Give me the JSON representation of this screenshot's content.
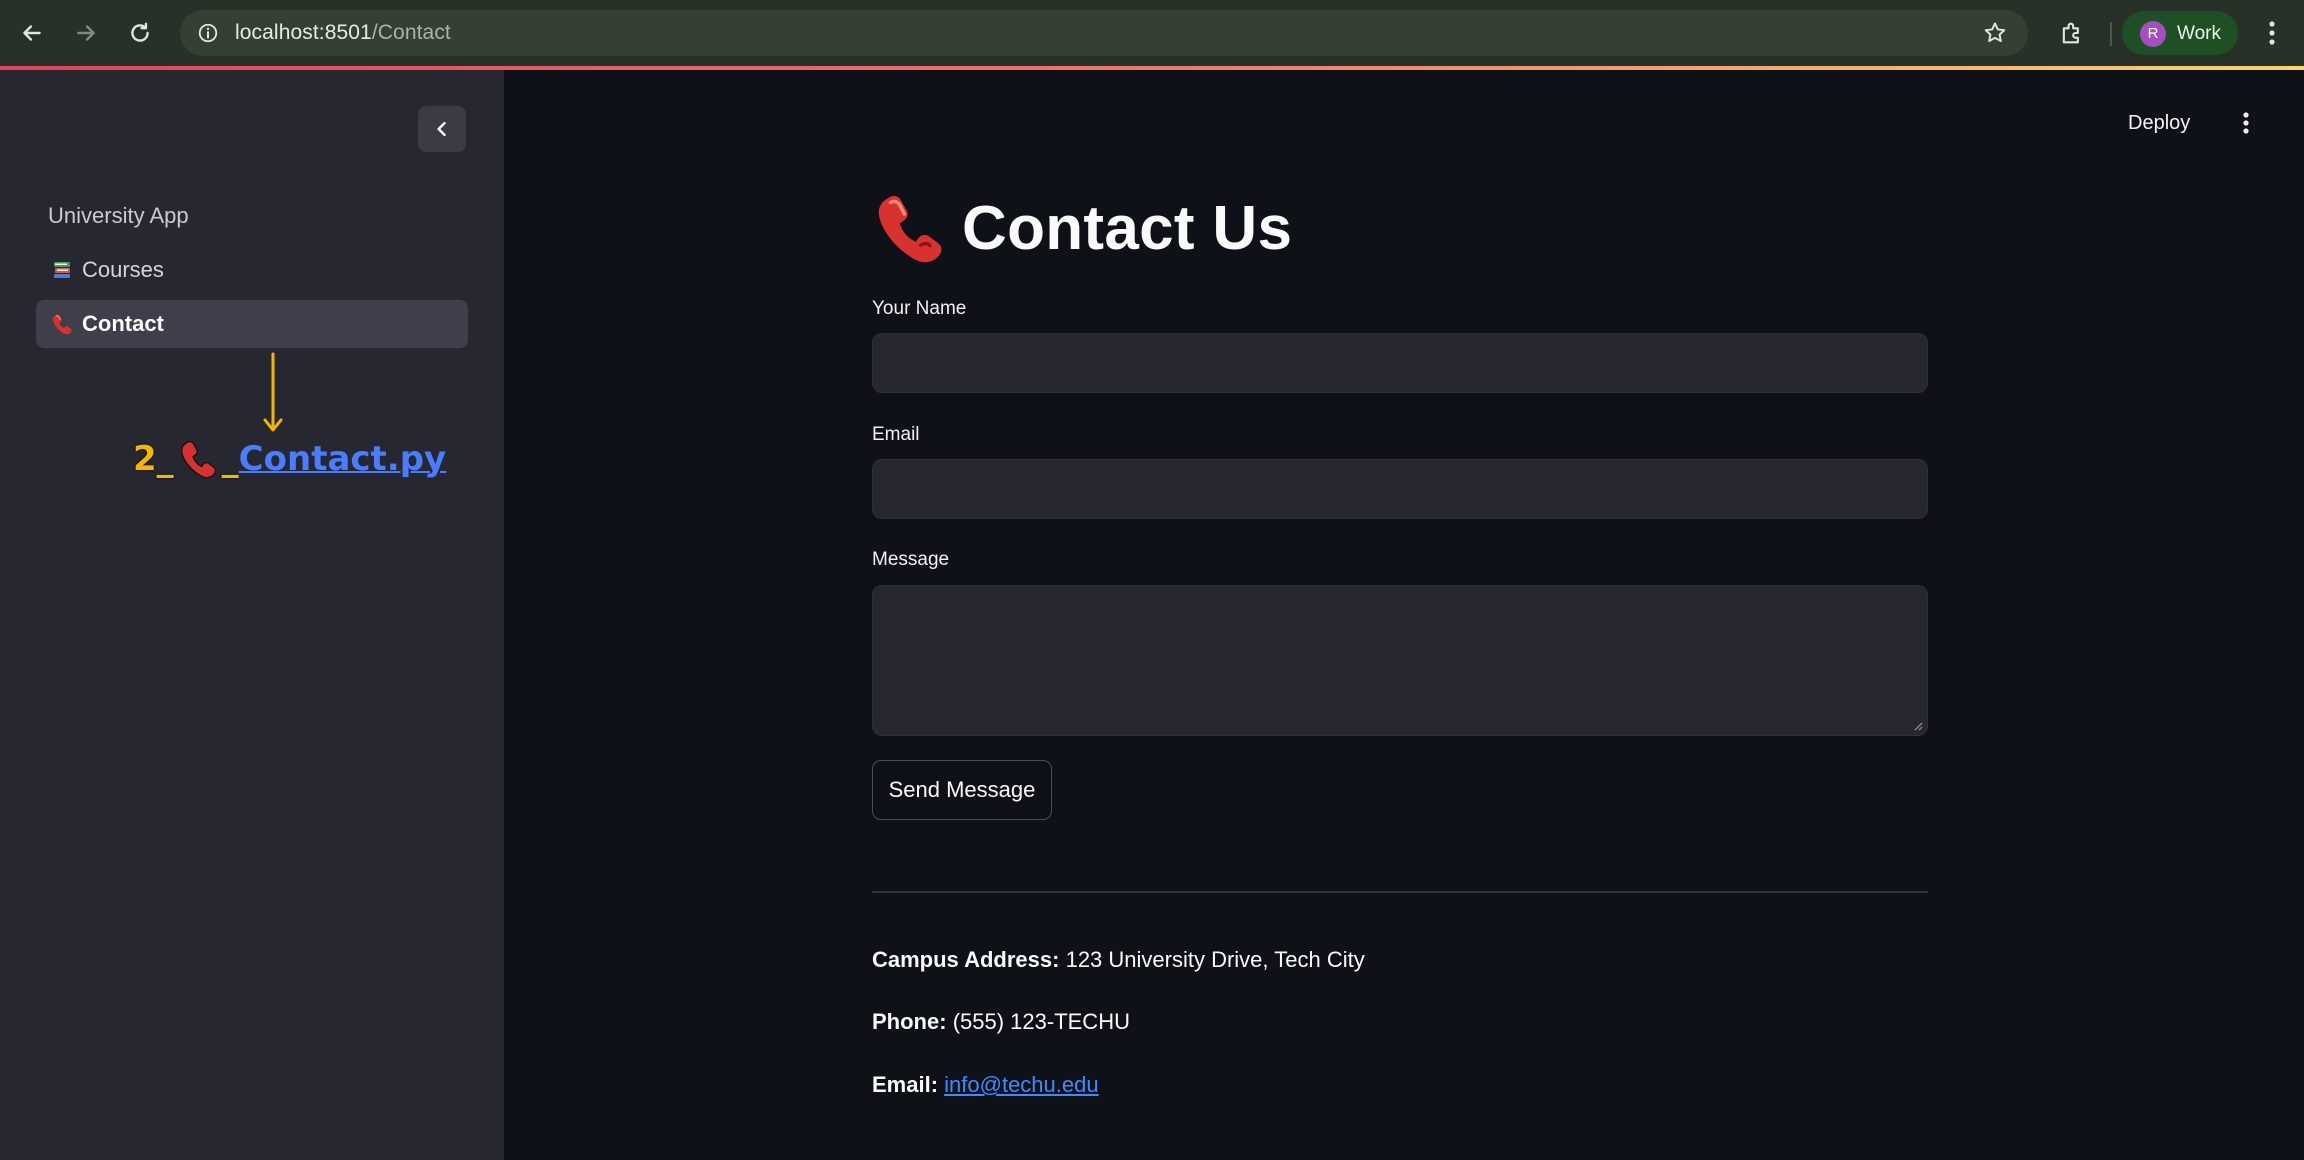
{
  "browser": {
    "url_host": "localhost:8501",
    "url_path": "/Contact",
    "profile_initial": "R",
    "profile_label": "Work"
  },
  "sidebar": {
    "heading": "University App",
    "items": [
      {
        "label": "Courses",
        "icon": "books-icon",
        "active": false
      },
      {
        "label": "Contact",
        "icon": "telephone-icon",
        "active": true
      }
    ],
    "annotation": {
      "prefix": "2_",
      "sep": "_",
      "filename": "Contact.py"
    }
  },
  "topbar": {
    "deploy_label": "Deploy"
  },
  "page": {
    "title": "Contact Us",
    "title_icon": "telephone-icon"
  },
  "form": {
    "name_label": "Your Name",
    "name_value": "",
    "email_label": "Email",
    "email_value": "",
    "message_label": "Message",
    "message_value": "",
    "submit_label": "Send Message"
  },
  "info": {
    "address_key": "Campus Address:",
    "address_value": "123 University Drive, Tech City",
    "phone_key": "Phone:",
    "phone_value": "(555) 123-TECHU",
    "email_key": "Email:",
    "email_value": "info@techu.edu"
  },
  "colors": {
    "app_background": "#0e1117",
    "sidebar_background": "#262730",
    "input_background": "#262730",
    "link": "#3d8bff",
    "annotation_arrow": "#f7b500",
    "annotation_file": "#4a7cff"
  }
}
